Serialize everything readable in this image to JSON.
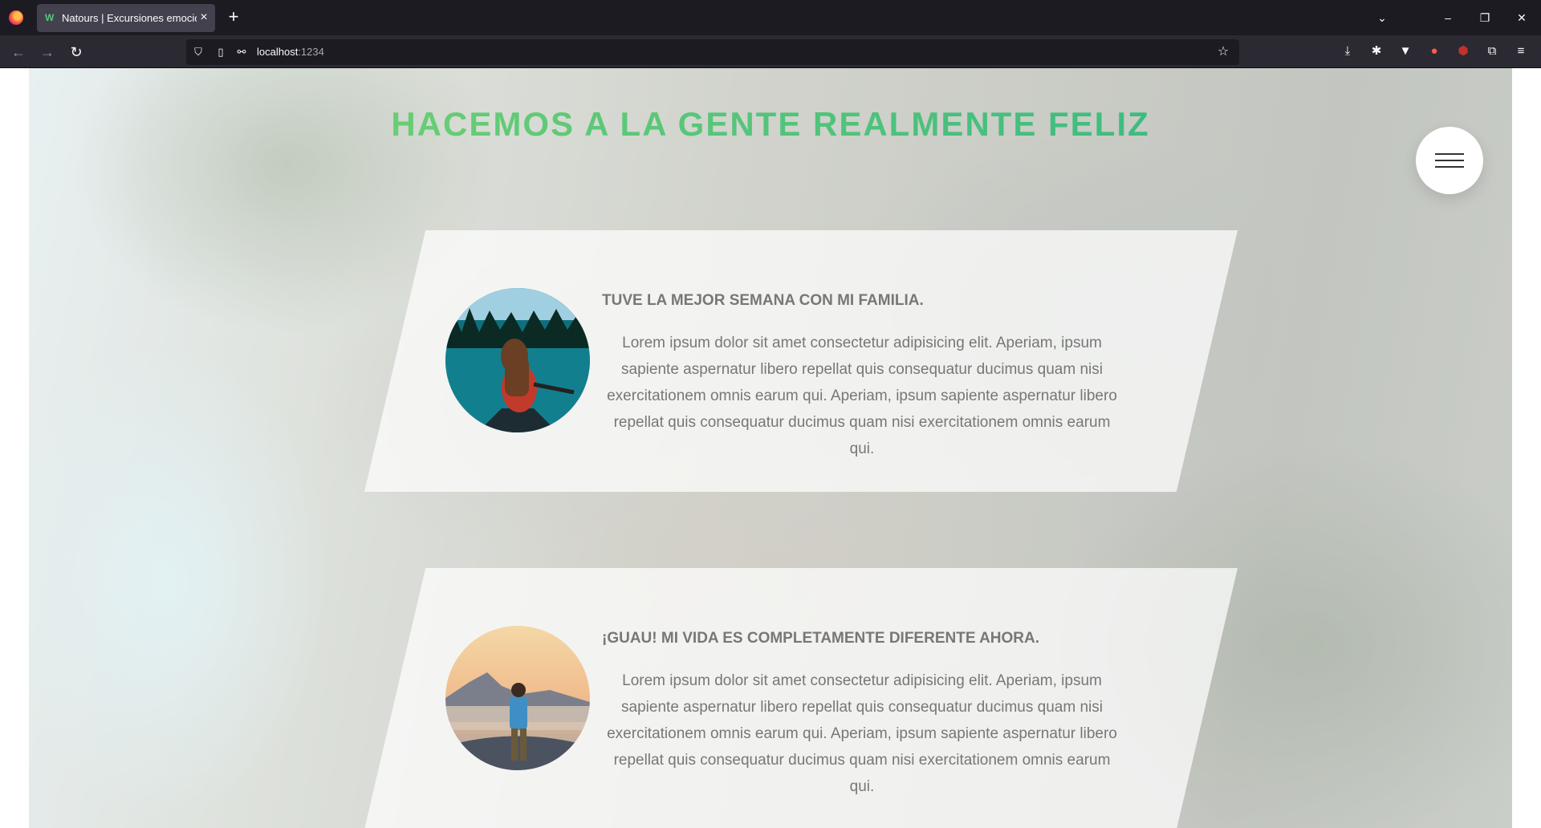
{
  "browser": {
    "tab_title": "Natours | Excursiones emocionantes",
    "url_host": "localhost",
    "url_port": ":1234",
    "icons": {
      "back": "back-arrow-icon",
      "forward": "forward-arrow-icon",
      "reload": "reload-icon",
      "bookmark": "star-icon"
    }
  },
  "page": {
    "heading": "HACEMOS A LA GENTE REALMENTE FELIZ",
    "stories": [
      {
        "title": "TUVE LA MEJOR SEMANA CON MI FAMILIA.",
        "text": "Lorem ipsum dolor sit amet consectetur adipisicing elit. Aperiam, ipsum sapiente aspernatur libero repellat quis consequatur ducimus quam nisi exercitationem omnis earum qui. Aperiam, ipsum sapiente aspernatur libero repellat quis consequatur ducimus quam nisi exercitationem omnis earum qui.",
        "avatar": "woman-in-canoe-photo"
      },
      {
        "title": "¡GUAU! MI VIDA ES COMPLETAMENTE DIFERENTE AHORA.",
        "text": "Lorem ipsum dolor sit amet consectetur adipisicing elit. Aperiam, ipsum sapiente aspernatur libero repellat quis consequatur ducimus quam nisi exercitationem omnis earum qui. Aperiam, ipsum sapiente aspernatur libero repellat quis consequatur ducimus quam nisi exercitationem omnis earum qui.",
        "avatar": "man-on-mountain-photo"
      }
    ]
  },
  "colors": {
    "heading_gradient_start": "#7ed56f",
    "heading_gradient_end": "#28b485",
    "story_text": "#777777"
  }
}
